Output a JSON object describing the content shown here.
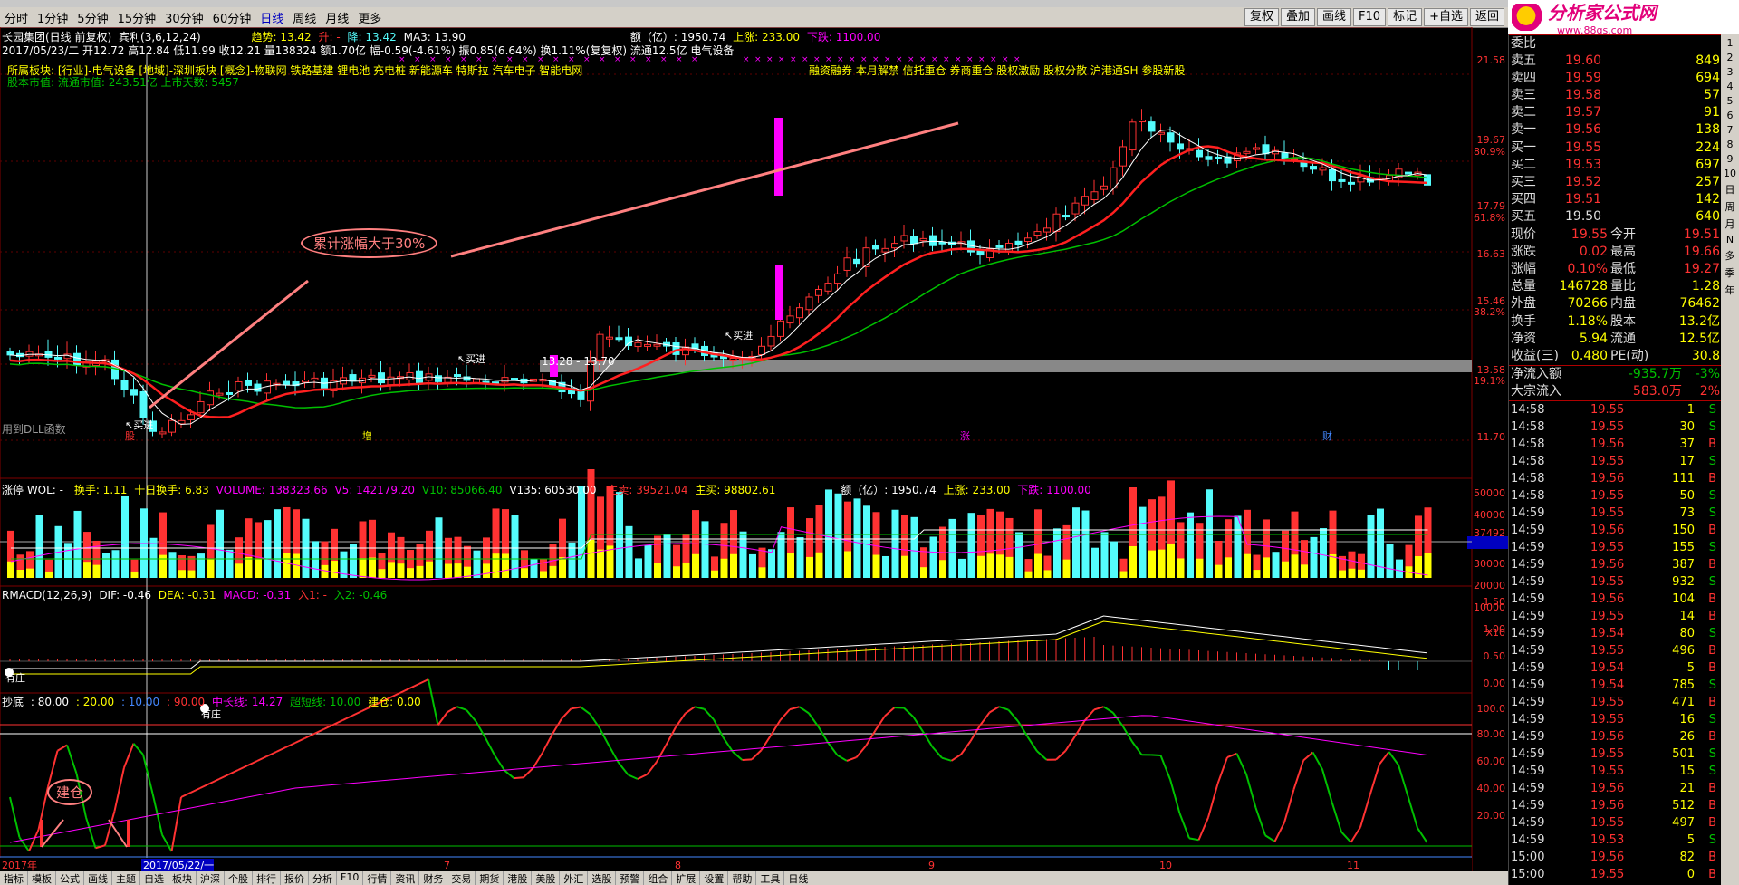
{
  "toolbar": {
    "periods": [
      "分时",
      "1分钟",
      "5分钟",
      "15分钟",
      "30分钟",
      "60分钟",
      "日线",
      "周线",
      "月线",
      "更多"
    ],
    "active_period": "日线",
    "right_buttons": [
      "复权",
      "叠加",
      "画线",
      "F10",
      "标记",
      "+自选",
      "返回"
    ]
  },
  "logo": {
    "title": "分析家公式网",
    "url": "www.88gs.com"
  },
  "kline": {
    "stock_title": "长园集团(日线 前复权)",
    "indicator": "宾利(3,6,12,24)",
    "trend_label": "趋势: 13.42",
    "up_label": "升: -",
    "down_label": "降: 13.42",
    "ma3_label": "MA3: 13.90",
    "amount_label": "额（亿）: 1950.74",
    "rise_label": "上涨: 233.00",
    "fall_label": "下跌: 1100.00",
    "info_line": "2017/05/23/二 开12.72 高12.84 低11.99 收12.21 量138324 额1.70亿 幅-0.59(-4.61%) 振0.85(6.64%) 换1.11%(复复权) 流通12.5亿 电气设备",
    "sector_line": "所属板块: [行业]-电气设备 [地域]-深圳板块 [概念]-物联网 铁路基建 锂电池 充电桩 新能源车 特斯拉 汽车电子 智能电网",
    "marketcap_line": "股本市值: 流通市值: 243.51亿 上市天数: 5457",
    "concept_line": "融资融券 本月解禁 信托重仓 券商重仓 股权激励 股权分散 沪港通SH 参股新股",
    "annotation": "累计涨幅大于30%",
    "buy_label": "买进",
    "range_label": "13.28 - 13.70",
    "dll_label": "用到DLL函数",
    "y_ticks": [
      "21.58",
      "19.67",
      "80.9%",
      "17.79",
      "61.8%",
      "16.63",
      "15.46",
      "38.2%",
      "13.58",
      "19.1%",
      "11.70"
    ],
    "event_labels": [
      "股",
      "增",
      "涨",
      "财"
    ]
  },
  "volume": {
    "title": "涨停 WOL: -",
    "turnover": "换手: 1.11",
    "ten_day": "十日换手: 6.83",
    "volume_val": "VOLUME: 138323.66",
    "v5": "V5: 142179.20",
    "v10": "V10: 85066.40",
    "v135": "V135: 60530.00",
    "main_sell": "主卖: 39521.04",
    "main_buy": "主买: 98802.61",
    "amount": "额（亿）: 1950.74",
    "rise": "上涨: 233.00",
    "fall": "下跌: 1100.00",
    "y_ticks": [
      "50000",
      "40000",
      "37492",
      "30000",
      "20000",
      "10000",
      "X10"
    ]
  },
  "macd": {
    "title": "RMACD(12,26,9)",
    "dif": "DIF: -0.46",
    "dea": "DEA: -0.31",
    "macd": "MACD: -0.31",
    "in1": "入1: -",
    "in2": "入2: -0.46",
    "y_ticks": [
      "1.50",
      "1.00",
      "0.50",
      "0.00"
    ],
    "labels": [
      "有庄",
      "有庄"
    ]
  },
  "bottom_ind": {
    "title": "抄底",
    "v80": ": 80.00",
    "v20": ": 20.00",
    "v10": ": 10.00",
    "v90": ": 90.00",
    "mid": "中长线: 14.27",
    "short": "超短线: 10.00",
    "build": "建仓: 0.00",
    "y_ticks": [
      "100.0",
      "80.00",
      "60.00",
      "40.00",
      "20.00"
    ],
    "annotation": "建仓"
  },
  "date_axis": {
    "labels": [
      "2017年",
      "2017/05/22/一",
      "7",
      "8",
      "9",
      "10",
      "11"
    ]
  },
  "bottom_tabs": [
    "指标",
    "模板",
    "公式",
    "画线",
    "主题",
    "自选",
    "板块",
    "沪深",
    "个股",
    "排行",
    "报价",
    "分析",
    "F10",
    "行情",
    "资讯",
    "财务",
    "交易",
    "期货",
    "港股",
    "美股",
    "外汇",
    "选股",
    "预警",
    "组合",
    "扩展",
    "设置",
    "帮助",
    "工具",
    "日线"
  ],
  "quote": {
    "webi_label": "委比",
    "asks": [
      {
        "name": "卖五",
        "price": "19.60",
        "vol": "849"
      },
      {
        "name": "卖四",
        "price": "19.59",
        "vol": "694"
      },
      {
        "name": "卖三",
        "price": "19.58",
        "vol": "57"
      },
      {
        "name": "卖二",
        "price": "19.57",
        "vol": "91"
      },
      {
        "name": "卖一",
        "price": "19.56",
        "vol": "138"
      }
    ],
    "bids": [
      {
        "name": "买一",
        "price": "19.55",
        "vol": "224"
      },
      {
        "name": "买二",
        "price": "19.53",
        "vol": "697"
      },
      {
        "name": "买三",
        "price": "19.52",
        "vol": "257"
      },
      {
        "name": "买四",
        "price": "19.51",
        "vol": "142"
      },
      {
        "name": "买五",
        "price": "19.50",
        "vol": "640"
      }
    ],
    "stats": [
      {
        "l1": "现价",
        "v1": "19.55",
        "l2": "今开",
        "v2": "19.51"
      },
      {
        "l1": "涨跌",
        "v1": "0.02",
        "l2": "最高",
        "v2": "19.66"
      },
      {
        "l1": "涨幅",
        "v1": "0.10%",
        "l2": "最低",
        "v2": "19.27"
      },
      {
        "l1": "总量",
        "v1": "146728",
        "l2": "量比",
        "v2": "1.28"
      },
      {
        "l1": "外盘",
        "v1": "70266",
        "l2": "内盘",
        "v2": "76462"
      }
    ],
    "stats2": [
      {
        "l1": "换手",
        "v1": "1.18%",
        "l2": "股本",
        "v2": "13.2亿"
      },
      {
        "l1": "净资",
        "v1": "5.94",
        "l2": "流通",
        "v2": "12.5亿"
      },
      {
        "l1": "收益(三)",
        "v1": "0.480",
        "l2": "PE(动)",
        "v2": "30.8"
      }
    ],
    "flows": [
      {
        "l": "净流入额",
        "v": "-935.7万",
        "p": "-3%"
      },
      {
        "l": "大宗流入",
        "v": "583.0万",
        "p": "2%"
      }
    ],
    "ticks": [
      [
        "14:58",
        "19.55",
        "1",
        "S"
      ],
      [
        "14:58",
        "19.55",
        "30",
        "S"
      ],
      [
        "14:58",
        "19.56",
        "37",
        "B"
      ],
      [
        "14:58",
        "19.55",
        "17",
        "S"
      ],
      [
        "14:58",
        "19.56",
        "111",
        "B"
      ],
      [
        "14:58",
        "19.55",
        "50",
        "S"
      ],
      [
        "14:59",
        "19.55",
        "73",
        "S"
      ],
      [
        "14:59",
        "19.56",
        "150",
        "B"
      ],
      [
        "14:59",
        "19.55",
        "155",
        "S"
      ],
      [
        "14:59",
        "19.56",
        "387",
        "B"
      ],
      [
        "14:59",
        "19.55",
        "932",
        "S"
      ],
      [
        "14:59",
        "19.56",
        "104",
        "B"
      ],
      [
        "14:59",
        "19.55",
        "14",
        "B"
      ],
      [
        "14:59",
        "19.54",
        "80",
        "S"
      ],
      [
        "14:59",
        "19.55",
        "496",
        "B"
      ],
      [
        "14:59",
        "19.54",
        "5",
        "B"
      ],
      [
        "14:59",
        "19.54",
        "785",
        "S"
      ],
      [
        "14:59",
        "19.55",
        "471",
        "B"
      ],
      [
        "14:59",
        "19.55",
        "16",
        "S"
      ],
      [
        "14:59",
        "19.56",
        "26",
        "B"
      ],
      [
        "14:59",
        "19.55",
        "501",
        "S"
      ],
      [
        "14:59",
        "19.55",
        "15",
        "S"
      ],
      [
        "14:59",
        "19.56",
        "21",
        "B"
      ],
      [
        "14:59",
        "19.56",
        "512",
        "B"
      ],
      [
        "14:59",
        "19.55",
        "497",
        "B"
      ],
      [
        "14:59",
        "19.53",
        "5",
        "S"
      ],
      [
        "15:00",
        "19.56",
        "82",
        "B"
      ],
      [
        "15:00",
        "19.55",
        "0",
        "B"
      ]
    ]
  },
  "side_tabs": [
    "1",
    "2",
    "3",
    "4",
    "5",
    "6",
    "7",
    "8",
    "9",
    "10",
    "日",
    "周",
    "月",
    "N",
    "多",
    "季",
    "年"
  ],
  "colors": {
    "up": "#ff3232",
    "down": "#54fcfc",
    "ma_white": "#ffffff",
    "ma_yellow": "#ffff00",
    "ma_green": "#00c000",
    "magenta": "#ff00ff"
  }
}
